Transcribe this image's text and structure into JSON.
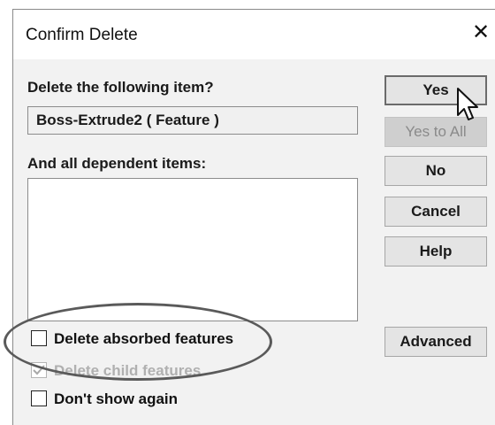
{
  "dialog": {
    "title": "Confirm Delete",
    "close_glyph": "✕",
    "prompt_label": "Delete the following item?",
    "item_value": "Boss-Extrude2 ( Feature )",
    "dependents_label": "And all dependent items:",
    "dependents_items": []
  },
  "buttons": {
    "yes": "Yes",
    "yes_to_all": "Yes to All",
    "no": "No",
    "cancel": "Cancel",
    "help": "Help",
    "advanced": "Advanced"
  },
  "checkboxes": [
    {
      "label": "Delete absorbed features",
      "checked": false,
      "enabled": true
    },
    {
      "label": "Delete child features",
      "checked": true,
      "enabled": false
    },
    {
      "label": "Don't show again",
      "checked": false,
      "enabled": true
    }
  ],
  "annotation": {
    "highlight": "oval around Delete absorbed features",
    "color": "#5a5a5a"
  },
  "icons": {
    "cursor": "mouse-pointer-icon",
    "check": "checkmark-icon"
  }
}
